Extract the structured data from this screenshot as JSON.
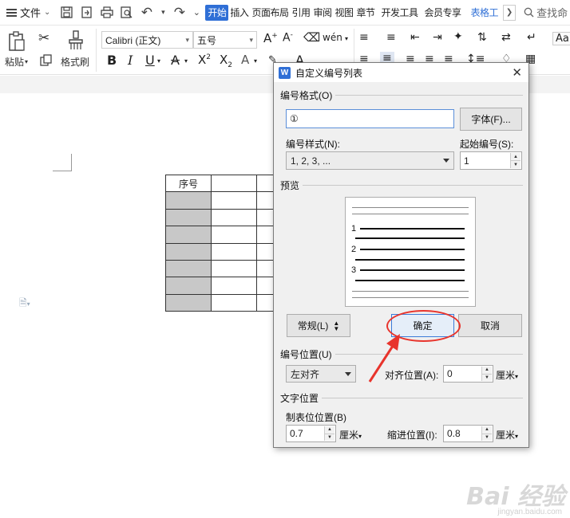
{
  "menubar": {
    "file_label": "文件",
    "tabs": [
      "开始",
      "插入",
      "页面布局",
      "引用",
      "审阅",
      "视图",
      "章节",
      "开发工具",
      "会员专享",
      "表格工"
    ],
    "search_label": "查找命"
  },
  "ribbon": {
    "paste_label": "粘贴",
    "format_painter_label": "格式刷",
    "font_name": "Calibri (正文)",
    "font_size": "五号"
  },
  "document": {
    "table_header": "序号"
  },
  "dialog": {
    "title": "自定义编号列表",
    "number_format_section": "编号格式(O)",
    "number_format_value": "①",
    "font_button": "字体(F)...",
    "number_style_label": "编号样式(N):",
    "number_style_value": "1, 2, 3, ...",
    "start_number_label": "起始编号(S):",
    "start_number_value": "1",
    "preview_section": "预览",
    "preview_numbers": [
      "1",
      "2",
      "3"
    ],
    "normal_button": "常规(L)",
    "ok_button": "确定",
    "cancel_button": "取消",
    "number_position_section": "编号位置(U)",
    "alignment_value": "左对齐",
    "align_position_label": "对齐位置(A):",
    "align_position_value": "0",
    "unit_cm": "厘米",
    "text_position_section": "文字位置",
    "tab_position_label": "制表位位置(B)",
    "tab_position_value": "0.7",
    "indent_position_label": "缩进位置(I):",
    "indent_position_value": "0.8"
  },
  "watermark": {
    "text": "Bai 经验",
    "url_text": "jingyan.baidu.com"
  },
  "colors": {
    "accent": "#2f6fd6",
    "annotation_red": "#e8342c",
    "header_gray": "#c8c8c8"
  }
}
